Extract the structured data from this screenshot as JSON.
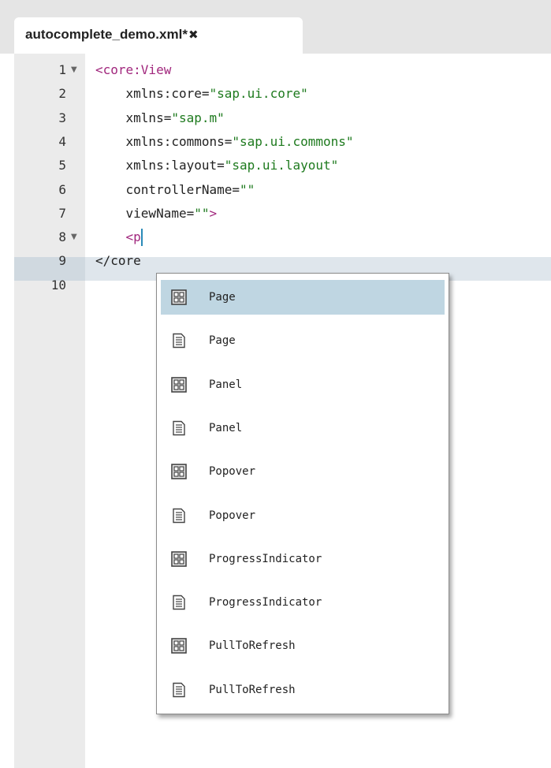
{
  "tab": {
    "title": "autocomplete_demo.xml*",
    "close_glyph": "✖"
  },
  "editor": {
    "lines": [
      {
        "num": "1",
        "fold": "▼",
        "parts": [
          {
            "t": "tag",
            "v": "<core:View"
          }
        ]
      },
      {
        "num": "2",
        "fold": "",
        "parts": [
          {
            "t": "plain",
            "v": "    "
          },
          {
            "t": "attr",
            "v": "xmlns:core"
          },
          {
            "t": "eq",
            "v": "="
          },
          {
            "t": "str",
            "v": "\"sap.ui.core\""
          }
        ]
      },
      {
        "num": "3",
        "fold": "",
        "parts": [
          {
            "t": "plain",
            "v": "    "
          },
          {
            "t": "attr",
            "v": "xmlns"
          },
          {
            "t": "eq",
            "v": "="
          },
          {
            "t": "str",
            "v": "\"sap.m\""
          }
        ]
      },
      {
        "num": "4",
        "fold": "",
        "parts": [
          {
            "t": "plain",
            "v": "    "
          },
          {
            "t": "attr",
            "v": "xmlns:commons"
          },
          {
            "t": "eq",
            "v": "="
          },
          {
            "t": "str",
            "v": "\"sap.ui.commons\""
          }
        ]
      },
      {
        "num": "5",
        "fold": "",
        "parts": [
          {
            "t": "plain",
            "v": "    "
          },
          {
            "t": "attr",
            "v": "xmlns:layout"
          },
          {
            "t": "eq",
            "v": "="
          },
          {
            "t": "str",
            "v": "\"sap.ui.layout\""
          }
        ]
      },
      {
        "num": "6",
        "fold": "",
        "parts": [
          {
            "t": "plain",
            "v": "    "
          },
          {
            "t": "attr",
            "v": "controllerName"
          },
          {
            "t": "eq",
            "v": "="
          },
          {
            "t": "str",
            "v": "\"\""
          }
        ]
      },
      {
        "num": "7",
        "fold": "",
        "parts": [
          {
            "t": "plain",
            "v": "    "
          },
          {
            "t": "attr",
            "v": "viewName"
          },
          {
            "t": "eq",
            "v": "="
          },
          {
            "t": "str",
            "v": "\"\""
          },
          {
            "t": "tag",
            "v": ">"
          }
        ]
      },
      {
        "num": "8",
        "fold": "▼",
        "parts": [
          {
            "t": "plain",
            "v": "    "
          },
          {
            "t": "tag",
            "v": "<p"
          }
        ],
        "cursor": true
      },
      {
        "num": "9",
        "fold": "",
        "parts": [
          {
            "t": "plain",
            "v": "</core"
          }
        ]
      },
      {
        "num": "10",
        "fold": "",
        "parts": []
      }
    ]
  },
  "autocomplete": {
    "items": [
      {
        "label": "Page",
        "icon": "control-icon",
        "selected": true
      },
      {
        "label": "Page",
        "icon": "document-icon"
      },
      {
        "label": "Panel",
        "icon": "control-icon"
      },
      {
        "label": "Panel",
        "icon": "document-icon"
      },
      {
        "label": "Popover",
        "icon": "control-icon"
      },
      {
        "label": "Popover",
        "icon": "document-icon"
      },
      {
        "label": "ProgressIndicator",
        "icon": "control-icon"
      },
      {
        "label": "ProgressIndicator",
        "icon": "document-icon"
      },
      {
        "label": "PullToRefresh",
        "icon": "control-icon"
      },
      {
        "label": "PullToRefresh",
        "icon": "document-icon"
      }
    ]
  },
  "colors": {
    "tag": "#a1277d",
    "string": "#1e7a1e",
    "selection": "#bfd6e2",
    "cursor": "#2a8ab8"
  }
}
